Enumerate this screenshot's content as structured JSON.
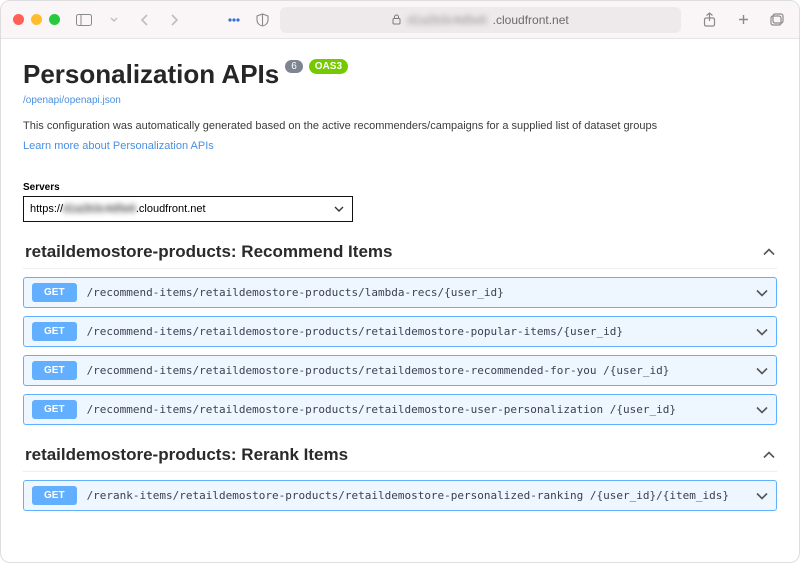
{
  "browser": {
    "address_host": ".cloudfront.net",
    "address_blurred_prefix": "d1a2b3c4d5e6"
  },
  "page": {
    "title": "Personalization APIs",
    "version_badge": "6",
    "oas_badge": "OAS3",
    "spec_link": "/openapi/openapi.json",
    "description": "This configuration was automatically generated based on the active recommenders/campaigns for a supplied list of dataset groups",
    "learn_more": "Learn more about Personalization APIs"
  },
  "servers": {
    "label": "Servers",
    "selected_prefix": "https://",
    "selected_blurred": "d1a2b3c4d5e6",
    "selected_suffix": ".cloudfront.net"
  },
  "tags": [
    {
      "name": "retaildemostore-products: Recommend Items",
      "ops": [
        {
          "method": "GET",
          "path": "/recommend-items/retaildemostore-products/lambda-recs/{user_id}"
        },
        {
          "method": "GET",
          "path": "/recommend-items/retaildemostore-products/retaildemostore-popular-items/{user_id}"
        },
        {
          "method": "GET",
          "path": "/recommend-items/retaildemostore-products/retaildemostore-recommended-for-you\n/{user_id}"
        },
        {
          "method": "GET",
          "path": "/recommend-items/retaildemostore-products/retaildemostore-user-personalization\n/{user_id}"
        }
      ]
    },
    {
      "name": "retaildemostore-products: Rerank Items",
      "ops": [
        {
          "method": "GET",
          "path": "/rerank-items/retaildemostore-products/retaildemostore-personalized-ranking\n/{user_id}/{item_ids}"
        }
      ]
    }
  ]
}
